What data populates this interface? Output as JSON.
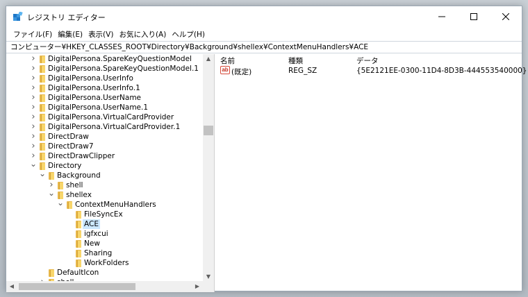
{
  "window": {
    "title": "レジストリ エディター"
  },
  "menu": [
    "ファイル(F)",
    "編集(E)",
    "表示(V)",
    "お気に入り(A)",
    "ヘルプ(H)"
  ],
  "address": "コンピューター¥HKEY_CLASSES_ROOT¥Directory¥Background¥shellex¥ContextMenuHandlers¥ACE",
  "tree": [
    {
      "label": "DigitalPersona.SpareKeyQuestionModel",
      "level": 0,
      "arrow": "collapsed"
    },
    {
      "label": "DigitalPersona.SpareKeyQuestionModel.1",
      "level": 0,
      "arrow": "collapsed"
    },
    {
      "label": "DigitalPersona.UserInfo",
      "level": 0,
      "arrow": "collapsed"
    },
    {
      "label": "DigitalPersona.UserInfo.1",
      "level": 0,
      "arrow": "collapsed"
    },
    {
      "label": "DigitalPersona.UserName",
      "level": 0,
      "arrow": "collapsed"
    },
    {
      "label": "DigitalPersona.UserName.1",
      "level": 0,
      "arrow": "collapsed"
    },
    {
      "label": "DigitalPersona.VirtualCardProvider",
      "level": 0,
      "arrow": "collapsed"
    },
    {
      "label": "DigitalPersona.VirtualCardProvider.1",
      "level": 0,
      "arrow": "collapsed"
    },
    {
      "label": "DirectDraw",
      "level": 0,
      "arrow": "collapsed"
    },
    {
      "label": "DirectDraw7",
      "level": 0,
      "arrow": "collapsed"
    },
    {
      "label": "DirectDrawClipper",
      "level": 0,
      "arrow": "collapsed"
    },
    {
      "label": "Directory",
      "level": 0,
      "arrow": "expanded"
    },
    {
      "label": "Background",
      "level": 1,
      "arrow": "expanded"
    },
    {
      "label": "shell",
      "level": 2,
      "arrow": "collapsed"
    },
    {
      "label": "shellex",
      "level": 2,
      "arrow": "expanded"
    },
    {
      "label": "ContextMenuHandlers",
      "level": 3,
      "arrow": "expanded"
    },
    {
      "label": " FileSyncEx",
      "level": 4,
      "arrow": "none"
    },
    {
      "label": "ACE",
      "level": 4,
      "arrow": "none",
      "selected": true
    },
    {
      "label": "igfxcui",
      "level": 4,
      "arrow": "none"
    },
    {
      "label": "New",
      "level": 4,
      "arrow": "none"
    },
    {
      "label": "Sharing",
      "level": 4,
      "arrow": "none"
    },
    {
      "label": "WorkFolders",
      "level": 4,
      "arrow": "none"
    },
    {
      "label": "DefaultIcon",
      "level": 1,
      "arrow": "none"
    },
    {
      "label": "shell",
      "level": 1,
      "arrow": "collapsed"
    }
  ],
  "columns": {
    "name": "名前",
    "type": "種類",
    "data": "データ"
  },
  "values": [
    {
      "icon": "ab",
      "name": "(既定)",
      "type": "REG_SZ",
      "data": "{5E2121EE-0300-11D4-8D3B-444553540000}"
    }
  ],
  "colors": {
    "selection": "#cce8ff",
    "folder": "#f8d66b"
  }
}
